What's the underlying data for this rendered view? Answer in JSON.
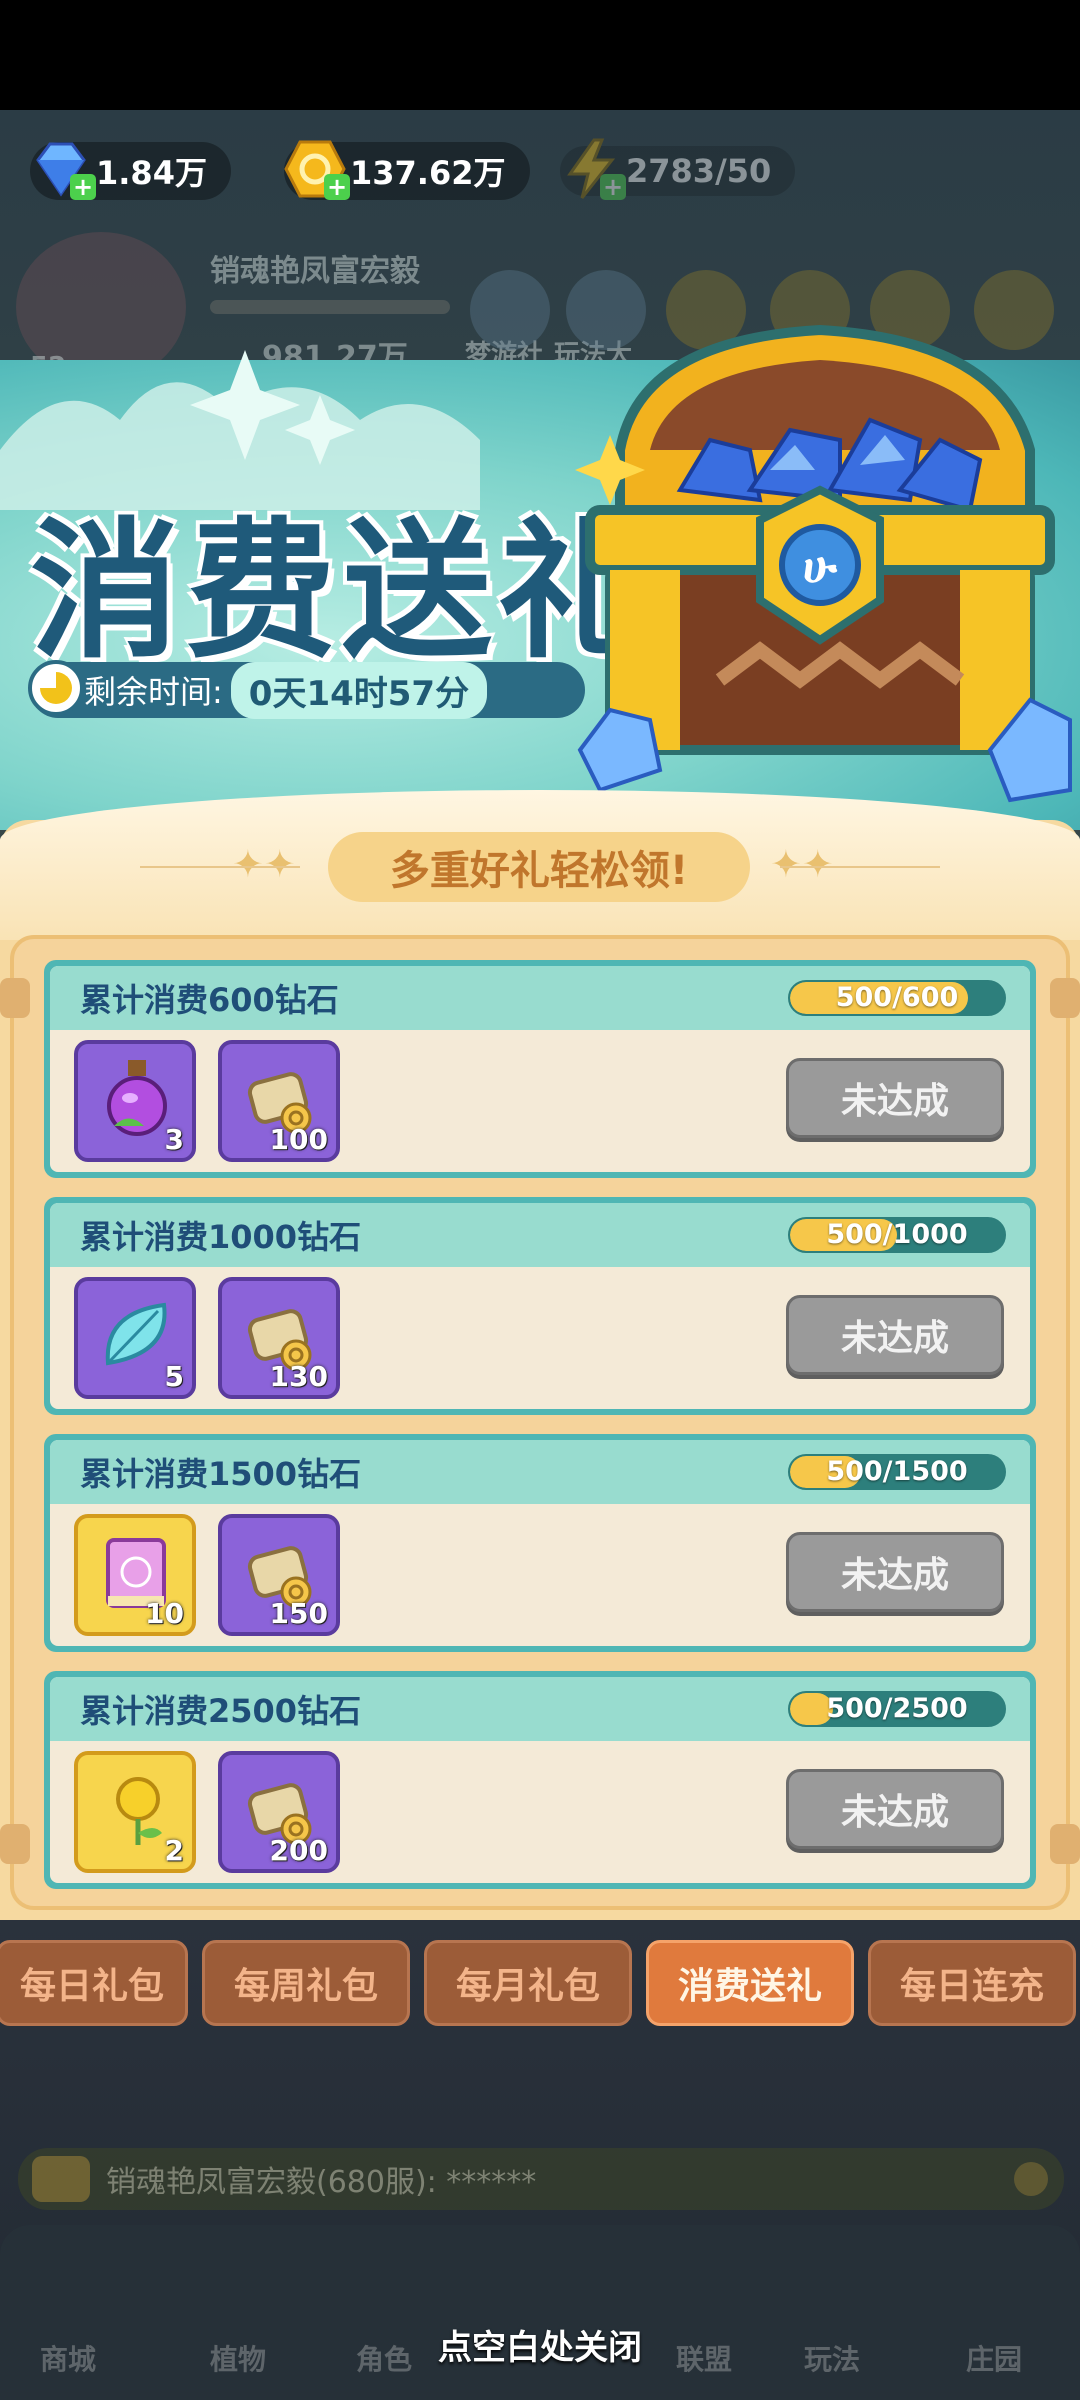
{
  "top_bar": {
    "diamonds": "1.84万",
    "coins": "137.62万",
    "energy": "2783/50"
  },
  "background": {
    "player_name": "销魂艳凤富宏毅",
    "player_level": "52",
    "player_power": "981.27万",
    "menu_1": "梦游社",
    "menu_2": "玩法大"
  },
  "banner": {
    "title": "消费送礼",
    "timer_label": "剩余时间:",
    "timer_value": "0天14时57分"
  },
  "panel": {
    "subtitle": "多重好礼轻松领!"
  },
  "tiers": [
    {
      "title": "累计消费600钻石",
      "progress_text": "500/600",
      "progress": 0.833,
      "button": "未达成",
      "rewards": [
        {
          "icon": "purple-potion-icon",
          "count": "3",
          "frame": "purple"
        },
        {
          "icon": "scroll-coin-icon",
          "count": "100",
          "frame": "purple"
        }
      ]
    },
    {
      "title": "累计消费1000钻石",
      "progress_text": "500/1000",
      "progress": 0.5,
      "button": "未达成",
      "rewards": [
        {
          "icon": "crystal-leaf-icon",
          "count": "5",
          "frame": "purple"
        },
        {
          "icon": "scroll-coin-icon",
          "count": "130",
          "frame": "purple"
        }
      ]
    },
    {
      "title": "累计消费1500钻石",
      "progress_text": "500/1500",
      "progress": 0.333,
      "button": "未达成",
      "rewards": [
        {
          "icon": "pink-book-icon",
          "count": "10",
          "frame": "gold"
        },
        {
          "icon": "scroll-coin-icon",
          "count": "150",
          "frame": "purple"
        }
      ]
    },
    {
      "title": "累计消费2500钻石",
      "progress_text": "500/2500",
      "progress": 0.2,
      "button": "未达成",
      "rewards": [
        {
          "icon": "golden-flower-icon",
          "count": "2",
          "frame": "gold"
        },
        {
          "icon": "scroll-coin-icon",
          "count": "200",
          "frame": "purple"
        }
      ]
    }
  ],
  "tabs": [
    "每日礼包",
    "每周礼包",
    "每月礼包",
    "消费送礼",
    "每日连充"
  ],
  "active_tab": "消费送礼",
  "chat": {
    "text": "销魂艳凤富宏毅(680服): ******"
  },
  "bottom": {
    "close_hint": "点空白处关闭",
    "nav_1": "商城",
    "nav_2": "植物",
    "nav_3": "角色",
    "nav_4": "联盟",
    "nav_5": "玩法",
    "nav_6": "庄园"
  },
  "colors": {
    "accent_teal": "#4fb6b4",
    "title_blue": "#1f4e78",
    "progress_fill": "#f6c74a",
    "button_disabled": "#9a9a9a",
    "tab_active": "#e07a3d"
  }
}
